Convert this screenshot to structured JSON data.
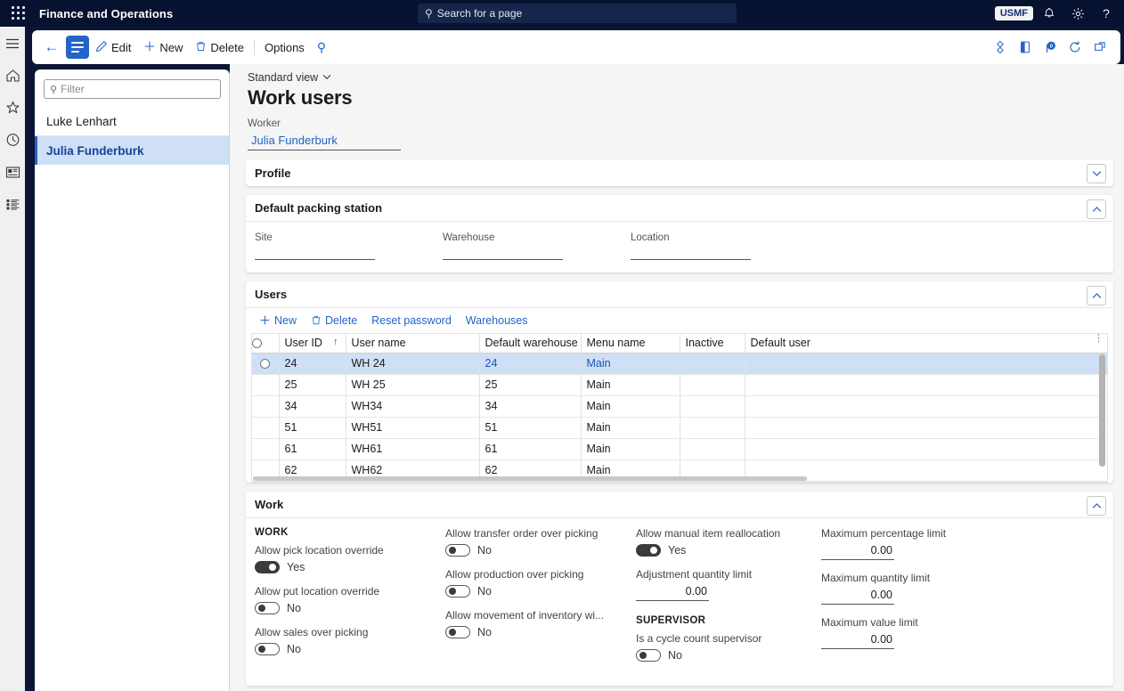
{
  "topbar": {
    "waffle_icon": "waffle-grid-icon",
    "app_title": "Finance and Operations",
    "search_placeholder": "Search for a page",
    "search_icon": "search-icon",
    "company": "USMF",
    "notifications_icon": "bell-icon",
    "settings_icon": "gear-icon",
    "help_icon": "question-icon"
  },
  "rail": {
    "items": [
      {
        "icon": "hamburger-icon",
        "name": "expand-navigation"
      },
      {
        "icon": "home-icon",
        "name": "home"
      },
      {
        "icon": "star-icon",
        "name": "favorites"
      },
      {
        "icon": "clock-icon",
        "name": "recent"
      },
      {
        "icon": "workspaces-icon",
        "name": "workspaces"
      },
      {
        "icon": "modules-icon",
        "name": "modules"
      }
    ]
  },
  "commandbar": {
    "back_icon": "back-arrow-icon",
    "show_list_icon": "show-list-icon",
    "edit_label": "Edit",
    "edit_icon": "pencil-icon",
    "new_label": "New",
    "new_icon": "plus-icon",
    "delete_label": "Delete",
    "delete_icon": "trash-icon",
    "options_label": "Options",
    "search_icon": "search-icon",
    "right_icons": [
      {
        "icon": "share-icon"
      },
      {
        "icon": "office-app-icon"
      },
      {
        "icon": "powerapps-icon",
        "badge": "0"
      },
      {
        "icon": "refresh-icon"
      },
      {
        "icon": "open-in-new-window-icon"
      }
    ]
  },
  "listpanel": {
    "filter_placeholder": "Filter",
    "filter_icon": "search-icon",
    "items": [
      {
        "label": "Luke Lenhart",
        "selected": false
      },
      {
        "label": "Julia Funderburk",
        "selected": true
      }
    ]
  },
  "page": {
    "view_selector": "Standard view",
    "view_chevron_icon": "chevron-down-icon",
    "title": "Work users",
    "worker_label": "Worker",
    "worker_value": "Julia Funderburk"
  },
  "sections": {
    "profile": {
      "title": "Profile",
      "expanded": false,
      "chevron_icon": "chevron-down-icon"
    },
    "packing": {
      "title": "Default packing station",
      "expanded": true,
      "chevron_icon": "chevron-up-icon",
      "fields": [
        {
          "label": "Site",
          "value": ""
        },
        {
          "label": "Warehouse",
          "value": ""
        },
        {
          "label": "Location",
          "value": ""
        }
      ]
    },
    "users": {
      "title": "Users",
      "expanded": true,
      "chevron_icon": "chevron-up-icon",
      "toolbar": [
        {
          "label": "New",
          "icon": "plus-icon"
        },
        {
          "label": "Delete",
          "icon": "trash-icon"
        },
        {
          "label": "Reset password",
          "icon": ""
        },
        {
          "label": "Warehouses",
          "icon": ""
        }
      ],
      "columns": [
        {
          "label": "User ID",
          "sorted": true,
          "sort_icon": "sort-ascending-icon"
        },
        {
          "label": "User name"
        },
        {
          "label": "Default warehouse"
        },
        {
          "label": "Menu name"
        },
        {
          "label": "Inactive"
        },
        {
          "label": "Default user"
        }
      ],
      "column_menu_icon": "column-options-icon",
      "rows": [
        {
          "user_id": "24",
          "user_name": "WH 24",
          "default_warehouse": "24",
          "menu_name": "Main",
          "inactive": "",
          "default_user": "",
          "selected": true
        },
        {
          "user_id": "25",
          "user_name": "WH 25",
          "default_warehouse": "25",
          "menu_name": "Main",
          "inactive": "",
          "default_user": "",
          "selected": false
        },
        {
          "user_id": "34",
          "user_name": "WH34",
          "default_warehouse": "34",
          "menu_name": "Main",
          "inactive": "",
          "default_user": "",
          "selected": false
        },
        {
          "user_id": "51",
          "user_name": "WH51",
          "default_warehouse": "51",
          "menu_name": "Main",
          "inactive": "",
          "default_user": "",
          "selected": false
        },
        {
          "user_id": "61",
          "user_name": "WH61",
          "default_warehouse": "61",
          "menu_name": "Main",
          "inactive": "",
          "default_user": "",
          "selected": false
        },
        {
          "user_id": "62",
          "user_name": "WH62",
          "default_warehouse": "62",
          "menu_name": "Main",
          "inactive": "",
          "default_user": "",
          "selected": false
        }
      ]
    },
    "work": {
      "title": "Work",
      "expanded": true,
      "chevron_icon": "chevron-up-icon",
      "group_work": "WORK",
      "group_supervisor": "SUPERVISOR",
      "col1": [
        {
          "label": "Allow pick location override",
          "value": "Yes",
          "on": true
        },
        {
          "label": "Allow put location override",
          "value": "No",
          "on": false
        },
        {
          "label": "Allow sales over picking",
          "value": "No",
          "on": false
        }
      ],
      "col2": [
        {
          "label": "Allow transfer order over picking",
          "value": "No",
          "on": false
        },
        {
          "label": "Allow production over picking",
          "value": "No",
          "on": false
        },
        {
          "label": "Allow movement of inventory wi...",
          "value": "No",
          "on": false
        }
      ],
      "col3_toggle": {
        "label": "Allow manual item reallocation",
        "value": "Yes",
        "on": true
      },
      "col3_number": {
        "label": "Adjustment quantity limit",
        "value": "0.00"
      },
      "col3_supervisor_toggle": {
        "label": "Is a cycle count supervisor",
        "value": "No",
        "on": false
      },
      "col4": [
        {
          "label": "Maximum percentage limit",
          "value": "0.00"
        },
        {
          "label": "Maximum quantity limit",
          "value": "0.00"
        },
        {
          "label": "Maximum value limit",
          "value": "0.00"
        }
      ]
    }
  },
  "colors": {
    "topbar_bg": "#061230",
    "accent": "#2364c6",
    "selection_bg": "#cfdff5",
    "page_bg": "#f5f5f5"
  }
}
